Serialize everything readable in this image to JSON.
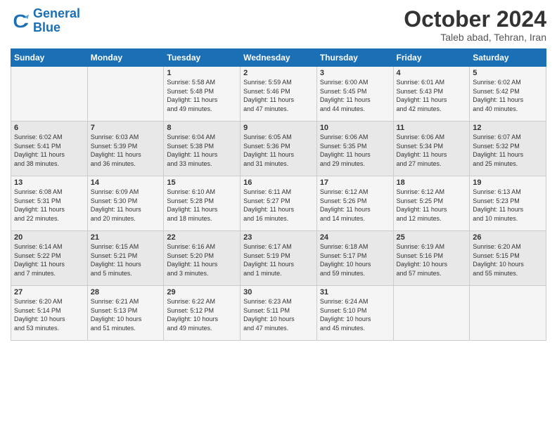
{
  "header": {
    "logo_line1": "General",
    "logo_line2": "Blue",
    "month": "October 2024",
    "location": "Taleb abad, Tehran, Iran"
  },
  "weekdays": [
    "Sunday",
    "Monday",
    "Tuesday",
    "Wednesday",
    "Thursday",
    "Friday",
    "Saturday"
  ],
  "weeks": [
    [
      {
        "day": "",
        "content": ""
      },
      {
        "day": "",
        "content": ""
      },
      {
        "day": "1",
        "content": "Sunrise: 5:58 AM\nSunset: 5:48 PM\nDaylight: 11 hours\nand 49 minutes."
      },
      {
        "day": "2",
        "content": "Sunrise: 5:59 AM\nSunset: 5:46 PM\nDaylight: 11 hours\nand 47 minutes."
      },
      {
        "day": "3",
        "content": "Sunrise: 6:00 AM\nSunset: 5:45 PM\nDaylight: 11 hours\nand 44 minutes."
      },
      {
        "day": "4",
        "content": "Sunrise: 6:01 AM\nSunset: 5:43 PM\nDaylight: 11 hours\nand 42 minutes."
      },
      {
        "day": "5",
        "content": "Sunrise: 6:02 AM\nSunset: 5:42 PM\nDaylight: 11 hours\nand 40 minutes."
      }
    ],
    [
      {
        "day": "6",
        "content": "Sunrise: 6:02 AM\nSunset: 5:41 PM\nDaylight: 11 hours\nand 38 minutes."
      },
      {
        "day": "7",
        "content": "Sunrise: 6:03 AM\nSunset: 5:39 PM\nDaylight: 11 hours\nand 36 minutes."
      },
      {
        "day": "8",
        "content": "Sunrise: 6:04 AM\nSunset: 5:38 PM\nDaylight: 11 hours\nand 33 minutes."
      },
      {
        "day": "9",
        "content": "Sunrise: 6:05 AM\nSunset: 5:36 PM\nDaylight: 11 hours\nand 31 minutes."
      },
      {
        "day": "10",
        "content": "Sunrise: 6:06 AM\nSunset: 5:35 PM\nDaylight: 11 hours\nand 29 minutes."
      },
      {
        "day": "11",
        "content": "Sunrise: 6:06 AM\nSunset: 5:34 PM\nDaylight: 11 hours\nand 27 minutes."
      },
      {
        "day": "12",
        "content": "Sunrise: 6:07 AM\nSunset: 5:32 PM\nDaylight: 11 hours\nand 25 minutes."
      }
    ],
    [
      {
        "day": "13",
        "content": "Sunrise: 6:08 AM\nSunset: 5:31 PM\nDaylight: 11 hours\nand 22 minutes."
      },
      {
        "day": "14",
        "content": "Sunrise: 6:09 AM\nSunset: 5:30 PM\nDaylight: 11 hours\nand 20 minutes."
      },
      {
        "day": "15",
        "content": "Sunrise: 6:10 AM\nSunset: 5:28 PM\nDaylight: 11 hours\nand 18 minutes."
      },
      {
        "day": "16",
        "content": "Sunrise: 6:11 AM\nSunset: 5:27 PM\nDaylight: 11 hours\nand 16 minutes."
      },
      {
        "day": "17",
        "content": "Sunrise: 6:12 AM\nSunset: 5:26 PM\nDaylight: 11 hours\nand 14 minutes."
      },
      {
        "day": "18",
        "content": "Sunrise: 6:12 AM\nSunset: 5:25 PM\nDaylight: 11 hours\nand 12 minutes."
      },
      {
        "day": "19",
        "content": "Sunrise: 6:13 AM\nSunset: 5:23 PM\nDaylight: 11 hours\nand 10 minutes."
      }
    ],
    [
      {
        "day": "20",
        "content": "Sunrise: 6:14 AM\nSunset: 5:22 PM\nDaylight: 11 hours\nand 7 minutes."
      },
      {
        "day": "21",
        "content": "Sunrise: 6:15 AM\nSunset: 5:21 PM\nDaylight: 11 hours\nand 5 minutes."
      },
      {
        "day": "22",
        "content": "Sunrise: 6:16 AM\nSunset: 5:20 PM\nDaylight: 11 hours\nand 3 minutes."
      },
      {
        "day": "23",
        "content": "Sunrise: 6:17 AM\nSunset: 5:19 PM\nDaylight: 11 hours\nand 1 minute."
      },
      {
        "day": "24",
        "content": "Sunrise: 6:18 AM\nSunset: 5:17 PM\nDaylight: 10 hours\nand 59 minutes."
      },
      {
        "day": "25",
        "content": "Sunrise: 6:19 AM\nSunset: 5:16 PM\nDaylight: 10 hours\nand 57 minutes."
      },
      {
        "day": "26",
        "content": "Sunrise: 6:20 AM\nSunset: 5:15 PM\nDaylight: 10 hours\nand 55 minutes."
      }
    ],
    [
      {
        "day": "27",
        "content": "Sunrise: 6:20 AM\nSunset: 5:14 PM\nDaylight: 10 hours\nand 53 minutes."
      },
      {
        "day": "28",
        "content": "Sunrise: 6:21 AM\nSunset: 5:13 PM\nDaylight: 10 hours\nand 51 minutes."
      },
      {
        "day": "29",
        "content": "Sunrise: 6:22 AM\nSunset: 5:12 PM\nDaylight: 10 hours\nand 49 minutes."
      },
      {
        "day": "30",
        "content": "Sunrise: 6:23 AM\nSunset: 5:11 PM\nDaylight: 10 hours\nand 47 minutes."
      },
      {
        "day": "31",
        "content": "Sunrise: 6:24 AM\nSunset: 5:10 PM\nDaylight: 10 hours\nand 45 minutes."
      },
      {
        "day": "",
        "content": ""
      },
      {
        "day": "",
        "content": ""
      }
    ]
  ]
}
